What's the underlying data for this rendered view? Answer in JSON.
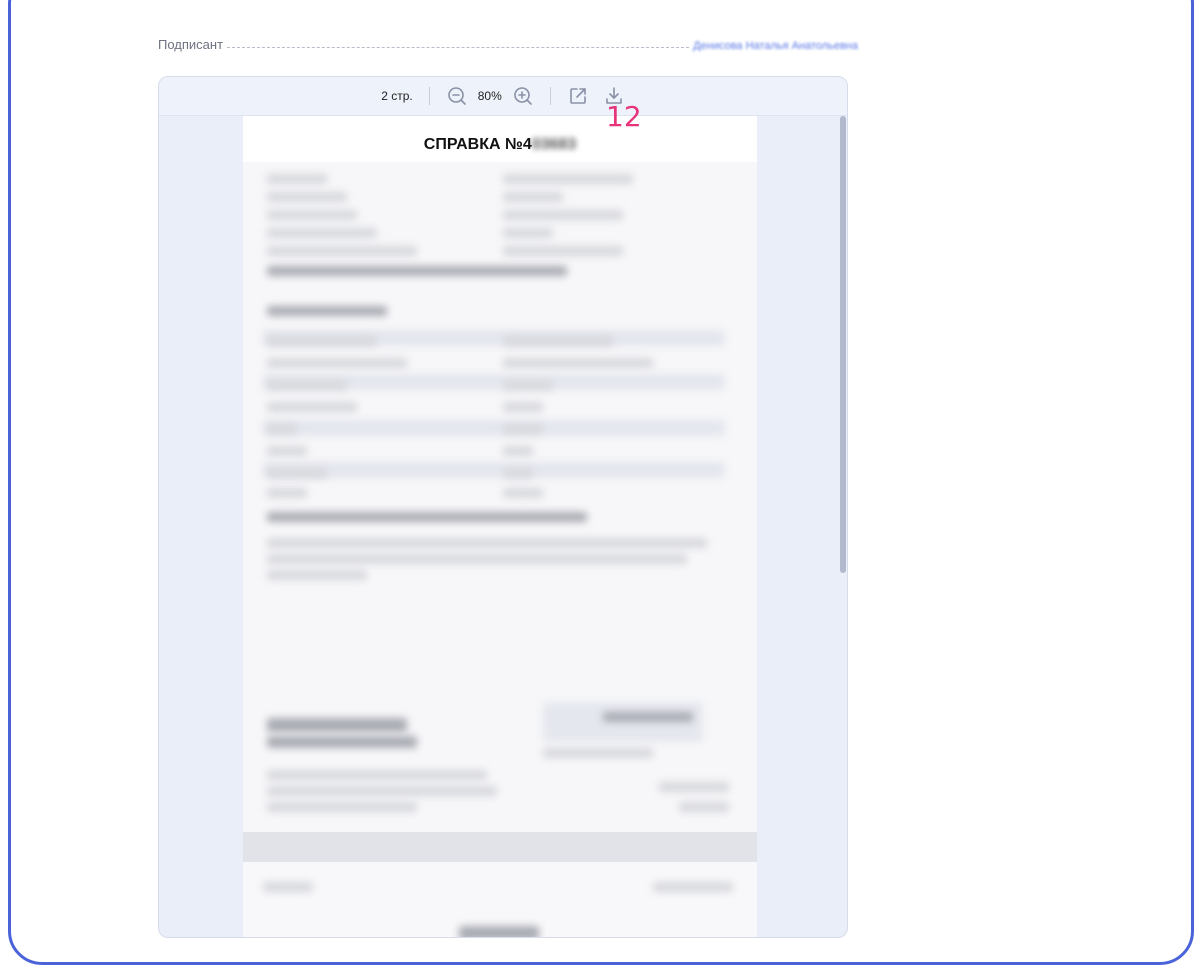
{
  "signer": {
    "label": "Подписант",
    "name": "Денисова Наталья Анатольевна"
  },
  "toolbar": {
    "page_count": "2 стр.",
    "zoom": "80%",
    "icons": [
      "zoom-out-icon",
      "zoom-in-icon",
      "open-external-icon",
      "download-icon"
    ]
  },
  "document": {
    "title_prefix": "СПРАВКА №4",
    "title_masked": "03683"
  },
  "page_number_annotation": "12",
  "colors": {
    "frame_border": "#4a63d8",
    "link": "#5b78e6",
    "annotation": "#e8347a",
    "viewer_bg": "#e9eef9"
  }
}
